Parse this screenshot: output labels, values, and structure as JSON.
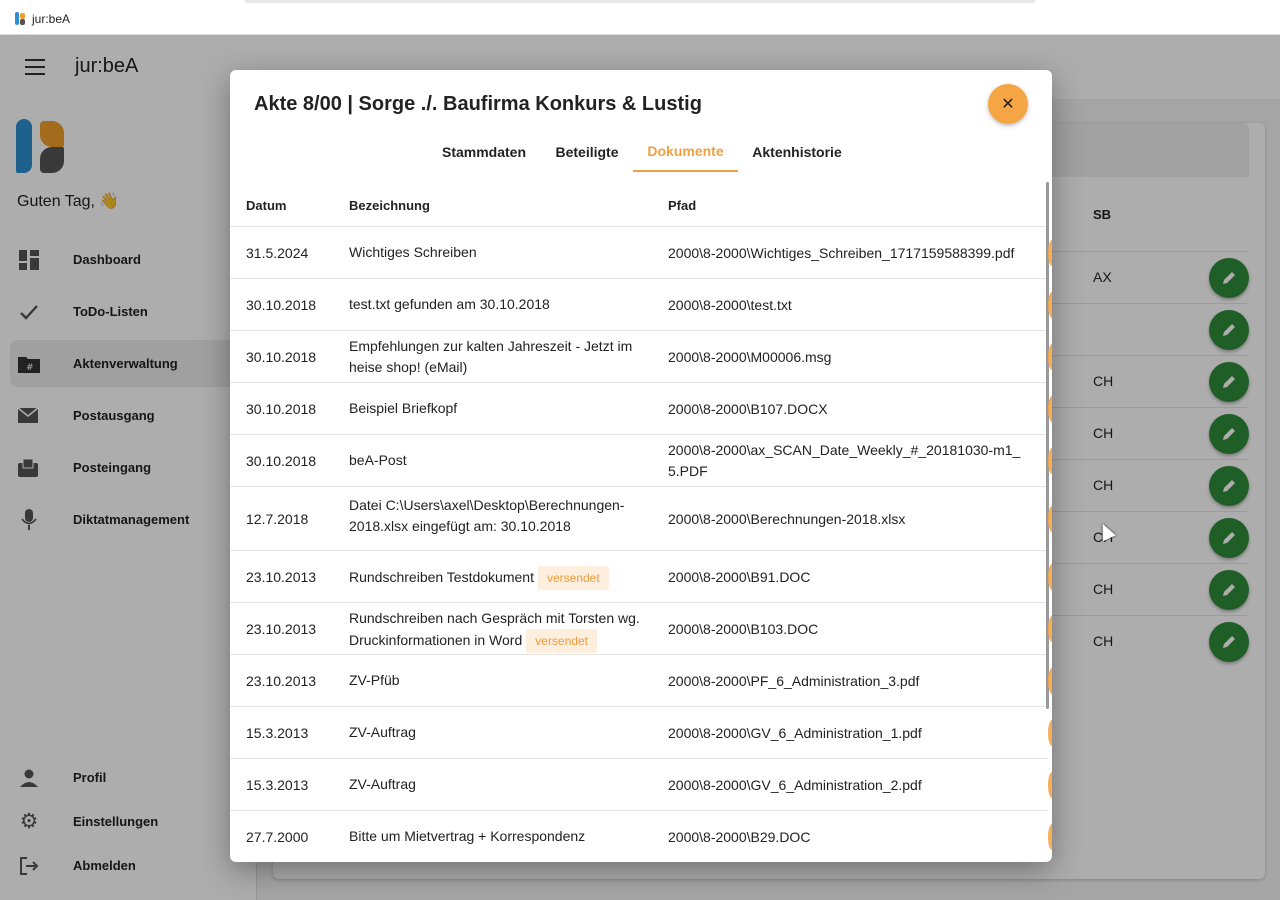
{
  "window": {
    "title": "jur:beA"
  },
  "app": {
    "title": "jur:beA",
    "greeting": "Guten Tag, 👋",
    "nav": [
      {
        "label": "Dashboard",
        "icon": "dashboard-icon"
      },
      {
        "label": "ToDo-Listen",
        "icon": "check-icon"
      },
      {
        "label": "Aktenverwaltung",
        "icon": "folder-icon"
      },
      {
        "label": "Postausgang",
        "icon": "mail-out-icon"
      },
      {
        "label": "Posteingang",
        "icon": "inbox-icon"
      },
      {
        "label": "Diktatmanagement",
        "icon": "mic-icon"
      }
    ],
    "nav_bottom": [
      {
        "label": "Profil",
        "icon": "person-icon"
      },
      {
        "label": "Einstellungen",
        "icon": "gear-icon"
      },
      {
        "label": "Abmelden",
        "icon": "logout-icon"
      }
    ],
    "background_table": {
      "sb_header": "SB",
      "rows": [
        "AX",
        "",
        "CH",
        "CH",
        "CH",
        "CH",
        "CH",
        "CH"
      ]
    }
  },
  "modal": {
    "title": "Akte 8/00 | Sorge ./. Baufirma Konkurs & Lustig",
    "close_label": "✕",
    "tabs": [
      "Stammdaten",
      "Beteiligte",
      "Dokumente",
      "Aktenhistorie"
    ],
    "active_tab": "Dokumente",
    "columns": [
      "Datum",
      "Bezeichnung",
      "Pfad"
    ],
    "rows": [
      {
        "date": "31.5.2024",
        "name": "Wichtiges Schreiben",
        "badge": "",
        "path": "2000\\8-2000\\Wichtiges_Schreiben_1717159588399.pdf"
      },
      {
        "date": "30.10.2018",
        "name": "test.txt gefunden am 30.10.2018",
        "badge": "",
        "path": "2000\\8-2000\\test.txt"
      },
      {
        "date": "30.10.2018",
        "name": "Empfehlungen zur kalten Jahreszeit - Jetzt im heise shop! (eMail)",
        "badge": "",
        "path": "2000\\8-2000\\M00006.msg"
      },
      {
        "date": "30.10.2018",
        "name": "Beispiel Briefkopf",
        "badge": "",
        "path": "2000\\8-2000\\B107.DOCX"
      },
      {
        "date": "30.10.2018",
        "name": "beA-Post",
        "badge": "",
        "path": "2000\\8-2000\\ax_SCAN_Date_Weekly_#_20181030-m1_5.PDF"
      },
      {
        "date": "12.7.2018",
        "name": "Datei C:\\Users\\axel\\Desktop\\Berechnungen-2018.xlsx eingefügt am: 30.10.2018",
        "badge": "",
        "path": "2000\\8-2000\\Berechnungen-2018.xlsx"
      },
      {
        "date": "23.10.2013",
        "name": "Rundschreiben Testdokument",
        "badge": "versendet",
        "path": "2000\\8-2000\\B91.DOC"
      },
      {
        "date": "23.10.2013",
        "name": "Rundschreiben nach Gespräch mit Torsten wg. Druckinformationen in Word",
        "badge": "versendet",
        "path": "2000\\8-2000\\B103.DOC"
      },
      {
        "date": "23.10.2013",
        "name": "ZV-Pfüb",
        "badge": "",
        "path": "2000\\8-2000\\PF_6_Administration_3.pdf"
      },
      {
        "date": "15.3.2013",
        "name": "ZV-Auftrag",
        "badge": "",
        "path": "2000\\8-2000\\GV_6_Administration_1.pdf"
      },
      {
        "date": "15.3.2013",
        "name": "ZV-Auftrag",
        "badge": "",
        "path": "2000\\8-2000\\GV_6_Administration_2.pdf"
      },
      {
        "date": "27.7.2000",
        "name": "Bitte um Mietvertrag + Korrespondenz",
        "badge": "",
        "path": "2000\\8-2000\\B29.DOC"
      }
    ]
  },
  "colors": {
    "accent": "#f6a544",
    "edit_button": "#2e8b3a"
  }
}
